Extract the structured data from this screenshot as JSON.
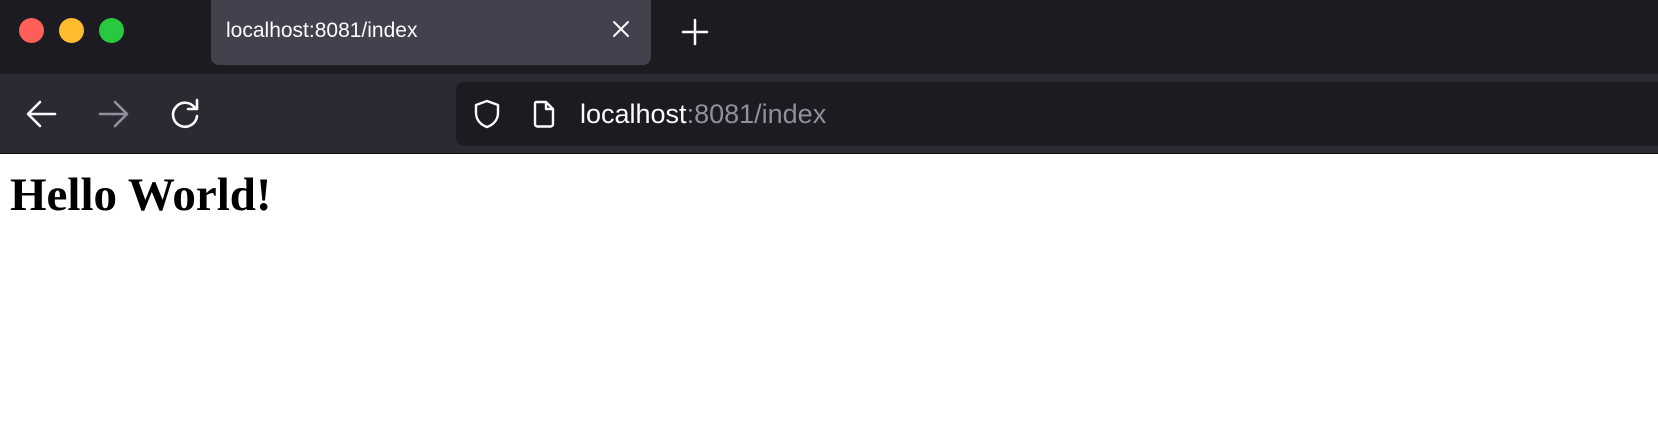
{
  "window": {
    "traffic_lights": {
      "close_color": "#ff5f57",
      "minimize_color": "#febc2e",
      "maximize_color": "#28c840"
    }
  },
  "tabs": [
    {
      "title": "localhost:8081/index",
      "active": true,
      "close_icon": "close-icon"
    }
  ],
  "new_tab_icon": "plus-icon",
  "toolbar": {
    "back_icon": "arrow-left-icon",
    "forward_icon": "arrow-right-icon",
    "forward_enabled": false,
    "reload_icon": "reload-icon"
  },
  "urlbar": {
    "security_icon": "shield-icon",
    "page_icon": "page-icon",
    "host": "localhost",
    "rest": ":8081/index"
  },
  "page": {
    "heading": "Hello World!"
  },
  "colors": {
    "tab_strip_bg": "#1c1b22",
    "active_tab_bg": "#42414d",
    "toolbar_bg": "#2b2a33",
    "urlbar_bg": "#1c1b22",
    "text_light": "#fbfbfe",
    "text_muted": "#8f8f9d"
  }
}
